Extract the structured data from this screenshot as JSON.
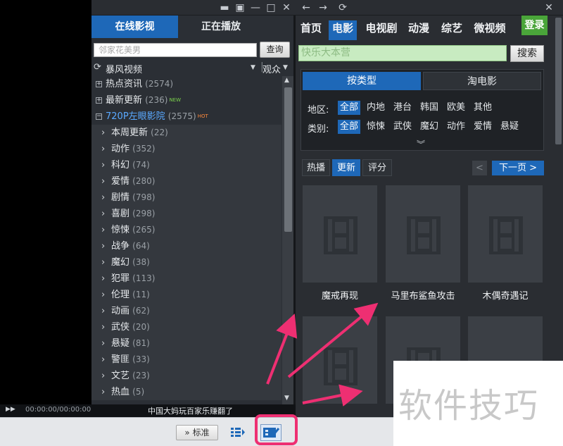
{
  "window_controls": [
    "chat-icon",
    "skin-icon",
    "minimize-icon",
    "maximize-icon",
    "close-icon"
  ],
  "browser_controls": [
    "back-icon",
    "forward-icon",
    "refresh-icon"
  ],
  "left": {
    "tabs": [
      "在线影视",
      "正在播放"
    ],
    "search_placeholder": "邻家花美男",
    "search_button": "查询",
    "source": "暴风视频",
    "sort": "观众",
    "top_items": [
      {
        "label": "热点资讯",
        "count": "(2574)",
        "badge": ""
      },
      {
        "label": "最新更新",
        "count": "(236)",
        "badge": "NEW"
      },
      {
        "label": "720P左眼影院",
        "count": "(2575)",
        "badge": "HOT"
      }
    ],
    "categories": [
      {
        "label": "本周更新",
        "count": "(22)"
      },
      {
        "label": "动作",
        "count": "(352)"
      },
      {
        "label": "科幻",
        "count": "(74)"
      },
      {
        "label": "爱情",
        "count": "(280)"
      },
      {
        "label": "剧情",
        "count": "(798)"
      },
      {
        "label": "喜剧",
        "count": "(298)"
      },
      {
        "label": "惊悚",
        "count": "(265)"
      },
      {
        "label": "战争",
        "count": "(64)"
      },
      {
        "label": "魔幻",
        "count": "(38)"
      },
      {
        "label": "犯罪",
        "count": "(113)"
      },
      {
        "label": "伦理",
        "count": "(11)"
      },
      {
        "label": "动画",
        "count": "(62)"
      },
      {
        "label": "武侠",
        "count": "(20)"
      },
      {
        "label": "悬疑",
        "count": "(81)"
      },
      {
        "label": "警匪",
        "count": "(33)"
      },
      {
        "label": "文艺",
        "count": "(23)"
      },
      {
        "label": "热血",
        "count": "(5)"
      }
    ]
  },
  "right": {
    "nav_tabs": [
      "首页",
      "电影",
      "电视剧",
      "动漫",
      "综艺",
      "微视频"
    ],
    "login": "登录",
    "search_placeholder": "快乐大本营",
    "search_button": "搜索",
    "filter_tabs": [
      "按类型",
      "淘电影"
    ],
    "region_label": "地区:",
    "regions": [
      "全部",
      "内地",
      "港台",
      "韩国",
      "欧美",
      "其他"
    ],
    "genre_label": "类别:",
    "genres": [
      "全部",
      "惊悚",
      "武侠",
      "魔幻",
      "动作",
      "爱情",
      "悬疑"
    ],
    "sort_tabs": [
      "热播",
      "更新",
      "评分"
    ],
    "prev": "<",
    "next": "下一页 >",
    "posters": [
      "魔戒再现",
      "马里布鲨鱼攻击",
      "木偶奇遇记"
    ]
  },
  "status": {
    "time": "00:00:00/00:00:00",
    "news": "中国大妈玩百家乐赚翻了"
  },
  "bottom": {
    "standard": "标准"
  },
  "watermark": "软件技巧",
  "colors": {
    "accent": "#1e68b8",
    "login": "#4aa53a",
    "annotation": "#ee2f72"
  }
}
